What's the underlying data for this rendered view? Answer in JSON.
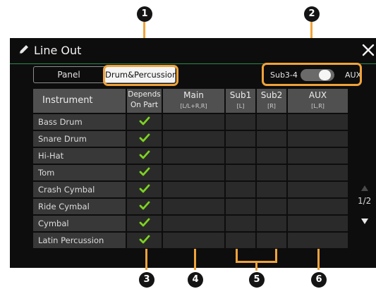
{
  "window": {
    "title": "Line Out"
  },
  "tabs": [
    {
      "label": "Panel",
      "selected": false
    },
    {
      "label": "Drum&Percussion",
      "selected": true
    }
  ],
  "toggle": {
    "left_label": "Sub3-4",
    "right_label": "AUX",
    "state": "AUX"
  },
  "table": {
    "headers": {
      "instrument": "Instrument",
      "depends_line1": "Depends",
      "depends_line2": "On Part",
      "main": "Main",
      "main_sub": "[L/L+R,R]",
      "sub1": "Sub1",
      "sub1_sub": "[L]",
      "sub2": "Sub2",
      "sub2_sub": "[R]",
      "aux": "AUX",
      "aux_sub": "[L,R]"
    },
    "rows": [
      {
        "instrument": "Bass Drum",
        "depends_on_part": true
      },
      {
        "instrument": "Snare Drum",
        "depends_on_part": true
      },
      {
        "instrument": "Hi-Hat",
        "depends_on_part": true
      },
      {
        "instrument": "Tom",
        "depends_on_part": true
      },
      {
        "instrument": "Crash Cymbal",
        "depends_on_part": true
      },
      {
        "instrument": "Ride Cymbal",
        "depends_on_part": true
      },
      {
        "instrument": "Cymbal",
        "depends_on_part": true
      },
      {
        "instrument": "Latin Percussion",
        "depends_on_part": true
      }
    ]
  },
  "pagination": {
    "label": "1/2",
    "current": 1,
    "total": 2
  },
  "callouts": [
    "1",
    "2",
    "3",
    "4",
    "5",
    "6"
  ],
  "colors": {
    "callout_line": "#f0a33a",
    "check": "#7ed321",
    "title_divider": "#2a8a4a",
    "screen_bg": "#0d0d0d"
  }
}
